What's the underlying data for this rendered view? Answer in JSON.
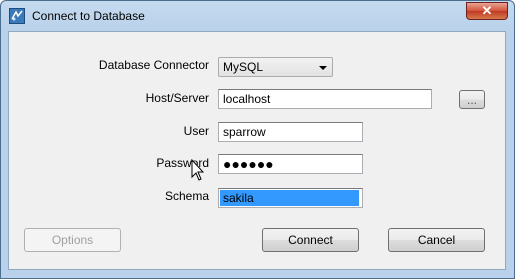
{
  "window": {
    "title": "Connect to Database",
    "close_label": "✕"
  },
  "form": {
    "connector_label": "Database Connector",
    "connector_value": "MySQL",
    "host_label": "Host/Server",
    "host_value": "localhost",
    "browse_label": "...",
    "user_label": "User",
    "user_value": "sparrow",
    "password_label": "Password",
    "password_value": "●●●●●●",
    "schema_label": "Schema",
    "schema_value": "sakila"
  },
  "buttons": {
    "options": "Options",
    "connect": "Connect",
    "cancel": "Cancel"
  },
  "colors": {
    "selection": "#3399ff",
    "titlebar": "#b9d1ea",
    "close": "#c13a25"
  },
  "icons": [
    "app-icon",
    "close-icon",
    "dropdown-arrow-icon",
    "mouse-cursor-icon"
  ]
}
